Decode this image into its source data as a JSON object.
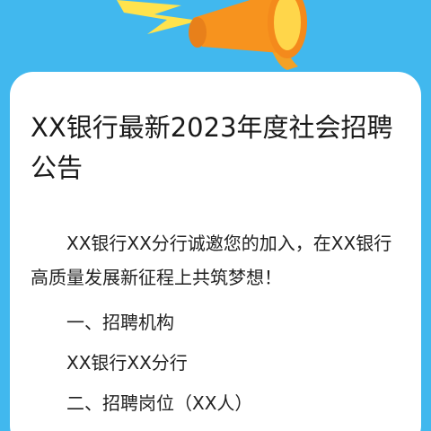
{
  "colors": {
    "background": "#41B8EE",
    "card": "#FFFFFF",
    "text": "#1A1A1A",
    "megaphone_orange": "#F7931E",
    "megaphone_yellow": "#FFD64A",
    "bolt_yellow": "#FFE34D"
  },
  "header": {
    "icon": "megaphone-icon",
    "bolt_icon": "lightning-icon"
  },
  "article": {
    "title": "XX银行最新2023年度社会招聘公告",
    "intro": "XX银行XX分行诚邀您的加入，在XX银行高质量发展新征程上共筑梦想！",
    "section1_heading": "一、招聘机构",
    "section1_body": "XX银行XX分行",
    "section2_heading": "二、招聘岗位（XX人）"
  }
}
